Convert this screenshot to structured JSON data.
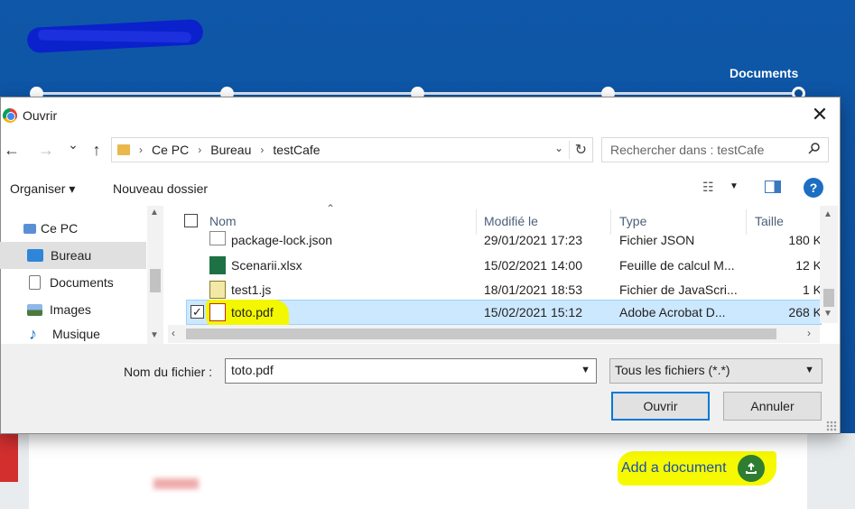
{
  "background": {
    "stepper_label": "Documents",
    "add_document_label": "Add a document"
  },
  "dialog": {
    "title": "Ouvrir",
    "close_glyph": "✕",
    "nav": {
      "back": "←",
      "forward": "→",
      "recent": "⌄",
      "up": "↑"
    },
    "breadcrumb": [
      "Ce PC",
      "Bureau",
      "testCafe"
    ],
    "search_placeholder": "Rechercher dans : testCafe",
    "toolbar": {
      "organiser": "Organiser ▾",
      "new_folder": "Nouveau dossier",
      "help": "?"
    },
    "nav_pane": [
      {
        "label": "Ce PC",
        "icon": "computer-icon",
        "selected": false
      },
      {
        "label": "Bureau",
        "icon": "desktop-icon",
        "selected": true
      },
      {
        "label": "Documents",
        "icon": "documents-icon",
        "selected": false
      },
      {
        "label": "Images",
        "icon": "images-icon",
        "selected": false
      },
      {
        "label": "Musique",
        "icon": "music-icon",
        "selected": false
      }
    ],
    "columns": {
      "name": "Nom",
      "modified": "Modifié le",
      "type": "Type",
      "size": "Taille"
    },
    "files": [
      {
        "name": "package-lock.json",
        "modified": "29/01/2021 17:23",
        "type": "Fichier JSON",
        "size": "180 K",
        "icon": "json-file-icon"
      },
      {
        "name": "Scenarii.xlsx",
        "modified": "15/02/2021 14:00",
        "type": "Feuille de calcul M...",
        "size": "12 K",
        "icon": "excel-file-icon"
      },
      {
        "name": "test1.js",
        "modified": "18/01/2021 18:53",
        "type": "Fichier de JavaScri...",
        "size": "1 K",
        "icon": "js-file-icon"
      },
      {
        "name": "toto.pdf",
        "modified": "15/02/2021 15:12",
        "type": "Adobe Acrobat D...",
        "size": "268 K",
        "icon": "pdf-file-icon",
        "selected": true
      }
    ],
    "filename_label": "Nom du fichier :",
    "filename_value": "toto.pdf",
    "filetype_value": "Tous les fichiers (*.*)",
    "open_button": "Ouvrir",
    "cancel_button": "Annuler"
  },
  "colors": {
    "header_blue": "#0c4f9b",
    "selection": "#cce8ff",
    "highlight": "#f3f700",
    "upload_green": "#2e7d32"
  }
}
